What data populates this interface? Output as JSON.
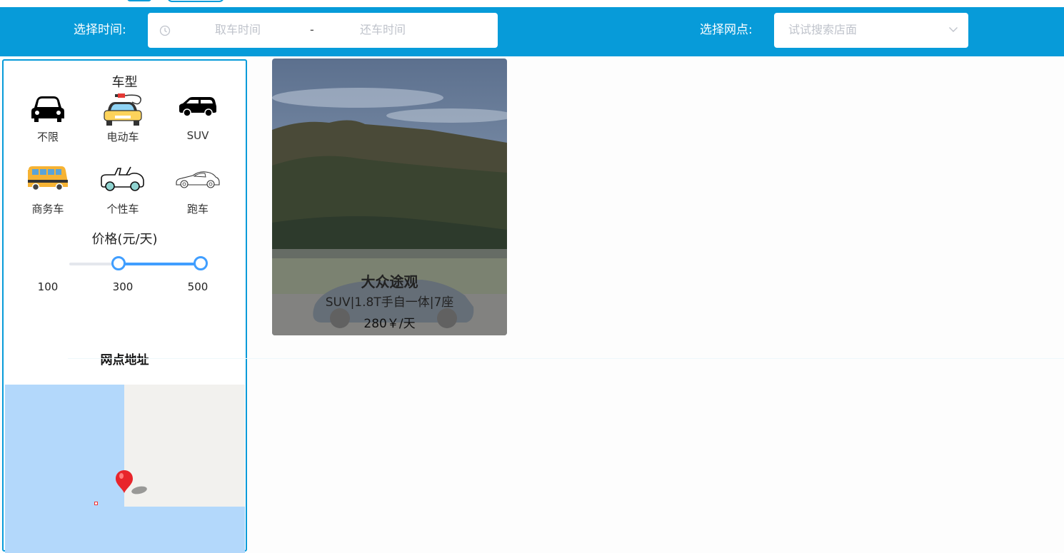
{
  "header": {
    "time_label": "选择时间:",
    "pickup_placeholder": "取车时间",
    "range_separator": "-",
    "return_placeholder": "还车时间",
    "store_label": "选择网点:",
    "store_placeholder": "试试搜索店面"
  },
  "filters": {
    "car_type_title": "车型",
    "car_types": [
      {
        "label": "不限",
        "icon": "sedan-icon"
      },
      {
        "label": "电动车",
        "icon": "electric-car-icon"
      },
      {
        "label": "SUV",
        "icon": "suv-icon"
      },
      {
        "label": "商务车",
        "icon": "bus-icon"
      },
      {
        "label": "个性车",
        "icon": "convertible-icon"
      },
      {
        "label": "跑车",
        "icon": "sports-car-icon"
      }
    ],
    "price_title": "价格(元/天)",
    "price_slider": {
      "min": 100,
      "max": 500,
      "selected_low": 250,
      "selected_high": 500,
      "ticks": [
        "100",
        "300",
        "500"
      ]
    },
    "address_title": "网点地址"
  },
  "cars": [
    {
      "name": "大众途观",
      "spec": "SUV|1.8T手自一体|7座",
      "price": "280￥/天"
    }
  ],
  "colors": {
    "primary": "#079bd9",
    "slider": "#409eff",
    "map_water": "#b3d8fb",
    "map_pin": "#e8252b"
  }
}
